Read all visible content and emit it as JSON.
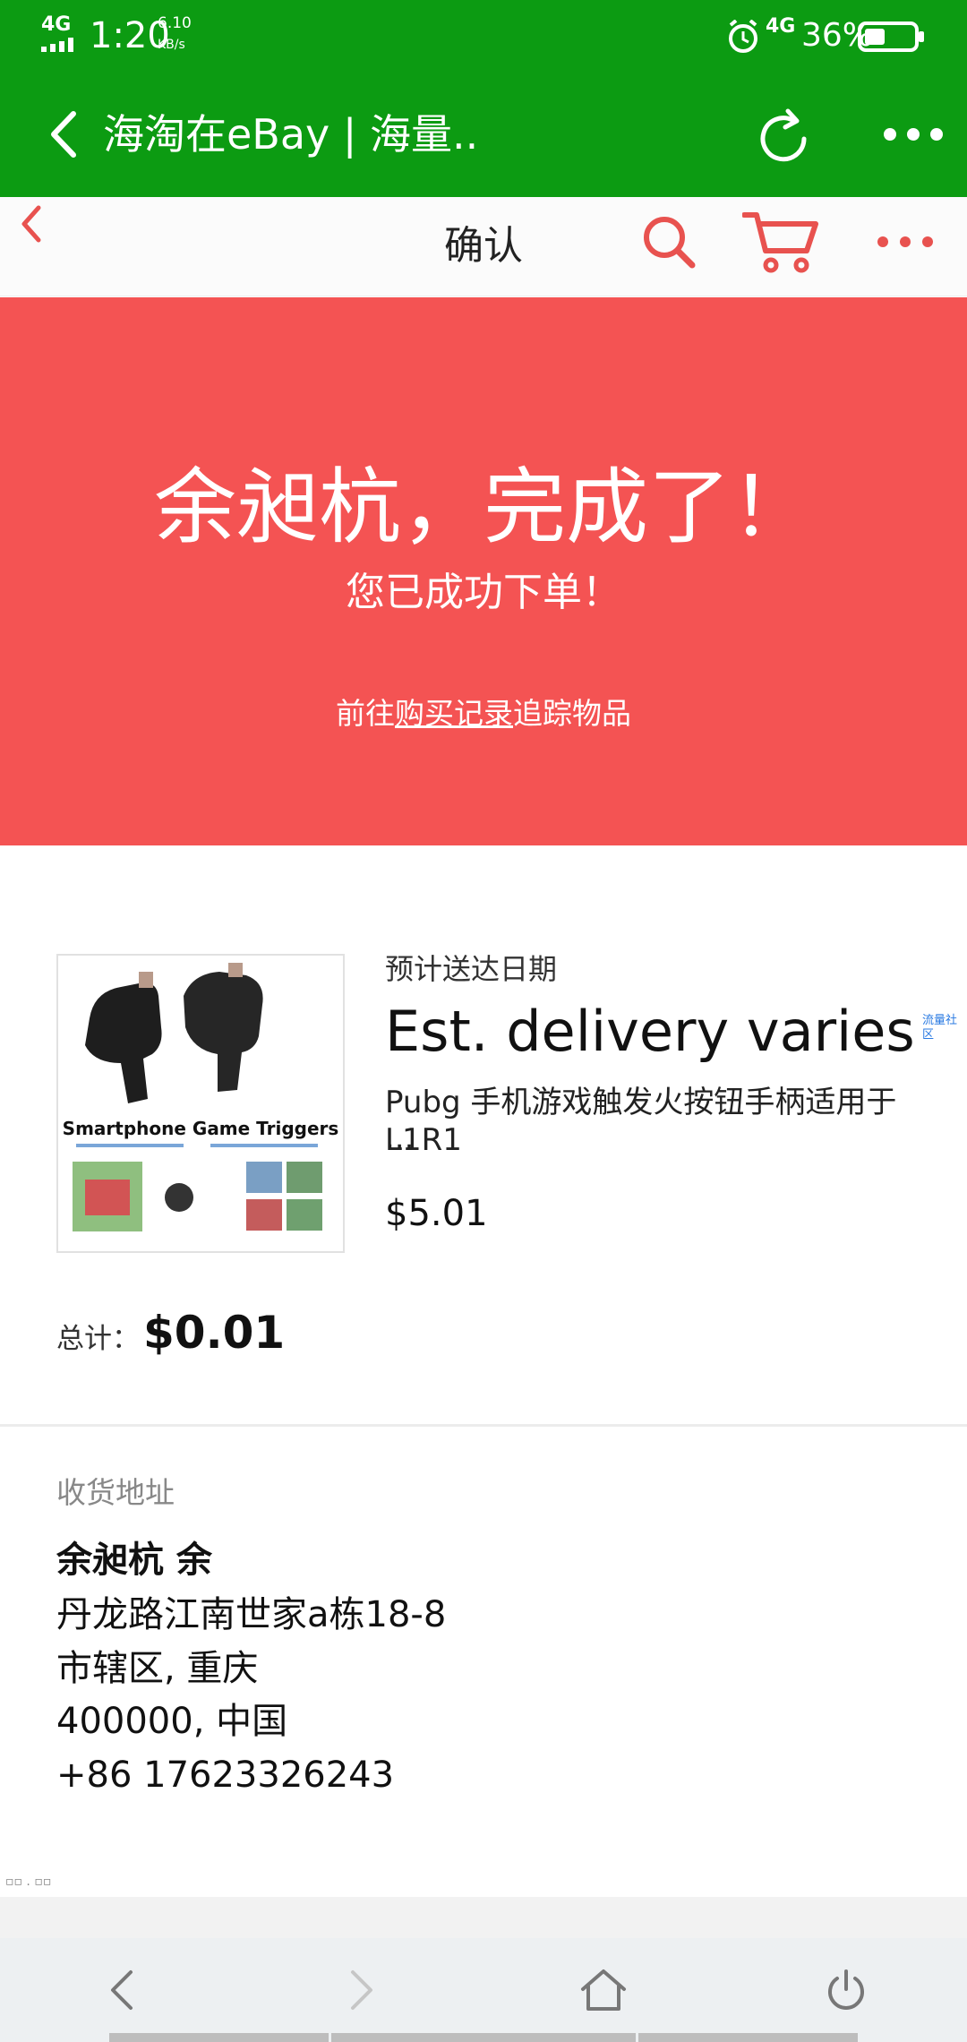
{
  "status_bar": {
    "network": "4G",
    "time": "1:20",
    "speed_value": "6.10",
    "speed_unit": "KB/s",
    "network_right": "4G",
    "battery": "36%"
  },
  "browser_bar": {
    "title": "海淘在eBay | 海量.."
  },
  "app_nav": {
    "title": "确认"
  },
  "hero": {
    "title": "余昶杭，完成了！",
    "subtitle": "您已成功下单！",
    "track_prefix": "前往",
    "track_link": "购买记录",
    "track_suffix": "追踪物品"
  },
  "order": {
    "est_label": "预计送达日期",
    "est_value": "Est. delivery varies",
    "item_name": "Pubg 手机游戏触发火按钮手柄适用于 L1R1",
    "item_more": "...",
    "item_price": "$5.01",
    "side_link": "流量社区",
    "total_label": "总计：",
    "total_value": "$0.01",
    "thumb_caption": "Smartphone Game Triggers"
  },
  "shipping": {
    "label": "收货地址",
    "name": "余昶杭 余",
    "line1": "丹龙路江南世家a栋18-8",
    "line2": "市辖区, 重庆",
    "line3": "400000, 中国",
    "phone": "+86 17623326243"
  },
  "footer": {
    "glyphs": "▫▫ . ▫▫"
  },
  "colors": {
    "browser_green": "#0c9b12",
    "accent_red": "#f45353",
    "icon_red": "#e8524f"
  },
  "icons": [
    "back-icon",
    "refresh-icon",
    "more-icon",
    "search-icon",
    "cart-icon",
    "home-icon",
    "power-icon",
    "forward-icon"
  ]
}
